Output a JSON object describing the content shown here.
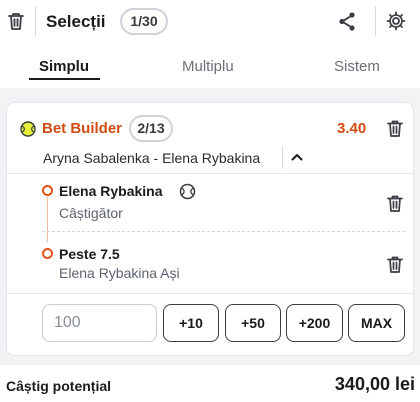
{
  "header": {
    "title": "Selecții",
    "count": "1/30",
    "icons": [
      "trash-icon",
      "share-icon",
      "gear-icon"
    ]
  },
  "tabs": [
    {
      "label": "Simplu",
      "active": true
    },
    {
      "label": "Multiplu",
      "active": false
    },
    {
      "label": "Sistem",
      "active": false
    }
  ],
  "bet_builder": {
    "title": "Bet Builder",
    "count": "2/13",
    "odds": "3.40",
    "match": "Aryna Sabalenka - Elena Rybakina",
    "selections": [
      {
        "name": "Elena Rybakina",
        "market": "Câștigător"
      },
      {
        "name": "Peste 7.5",
        "market": "Elena Rybakina Ași"
      }
    ]
  },
  "stake": {
    "placeholder": "100",
    "quick_amounts": [
      "+10",
      "+50",
      "+200",
      "MAX"
    ]
  },
  "footer": {
    "label": "Câștig potențial",
    "value": "340,00 lei"
  },
  "colors": {
    "accent": "#d14b12",
    "text": "#1b1b1b",
    "background": "#f2f3f5"
  }
}
